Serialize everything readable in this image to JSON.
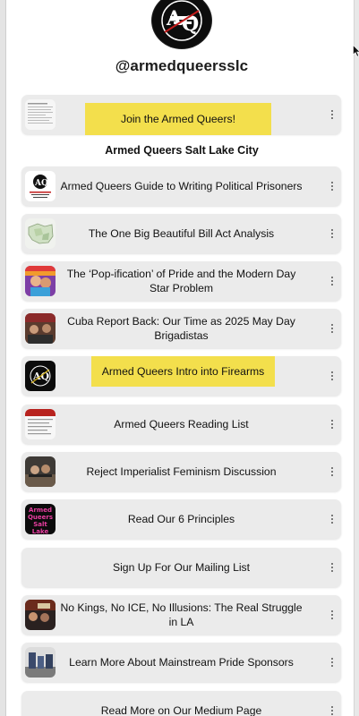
{
  "profile": {
    "handle": "@armedqueersslc",
    "avatar_icon": "armed-queers-logo-icon"
  },
  "header_button": {
    "label": "Join the Armed Queers!",
    "highlight_color": "#f3df4c"
  },
  "section": {
    "title": "Armed Queers Salt Lake City"
  },
  "links": [
    {
      "label": "Armed Queers Guide to Writing Political Prisoners",
      "thumb": "guide-thumbnail"
    },
    {
      "label": "The One Big Beautiful Bill Act Analysis",
      "thumb": "map-thumbnail"
    },
    {
      "label": "The ‘Pop-ification’ of Pride and the Modern Day Star Problem",
      "thumb": "pride-thumbnail"
    },
    {
      "label": "Cuba Report Back: Our Time as 2025 May Day Brigadistas",
      "thumb": "cuba-thumbnail"
    },
    {
      "label": "Armed Queers Intro into Firearms",
      "thumb": "aq-logo-thumbnail"
    },
    {
      "label": "Armed Queers Reading List",
      "thumb": "reading-list-thumbnail"
    },
    {
      "label": "Reject Imperialist Feminism Discussion",
      "thumb": "discussion-thumbnail"
    },
    {
      "label": "Read Our 6 Principles",
      "thumb": "principles-thumbnail",
      "thumb_text": "Armed Queers Salt Lake City"
    },
    {
      "label": "Sign Up For Our Mailing List",
      "thumb": ""
    },
    {
      "label": "No Kings, No ICE, No Illusions: The Real Struggle in LA",
      "thumb": "la-thumbnail"
    },
    {
      "label": "Learn More About Mainstream Pride Sponsors",
      "thumb": "sponsors-thumbnail"
    },
    {
      "label": "Read More on Our Medium Page",
      "thumb": ""
    }
  ],
  "colors": {
    "card_bg": "#ebebeb",
    "highlight": "#f3df4c",
    "text": "#111111"
  }
}
